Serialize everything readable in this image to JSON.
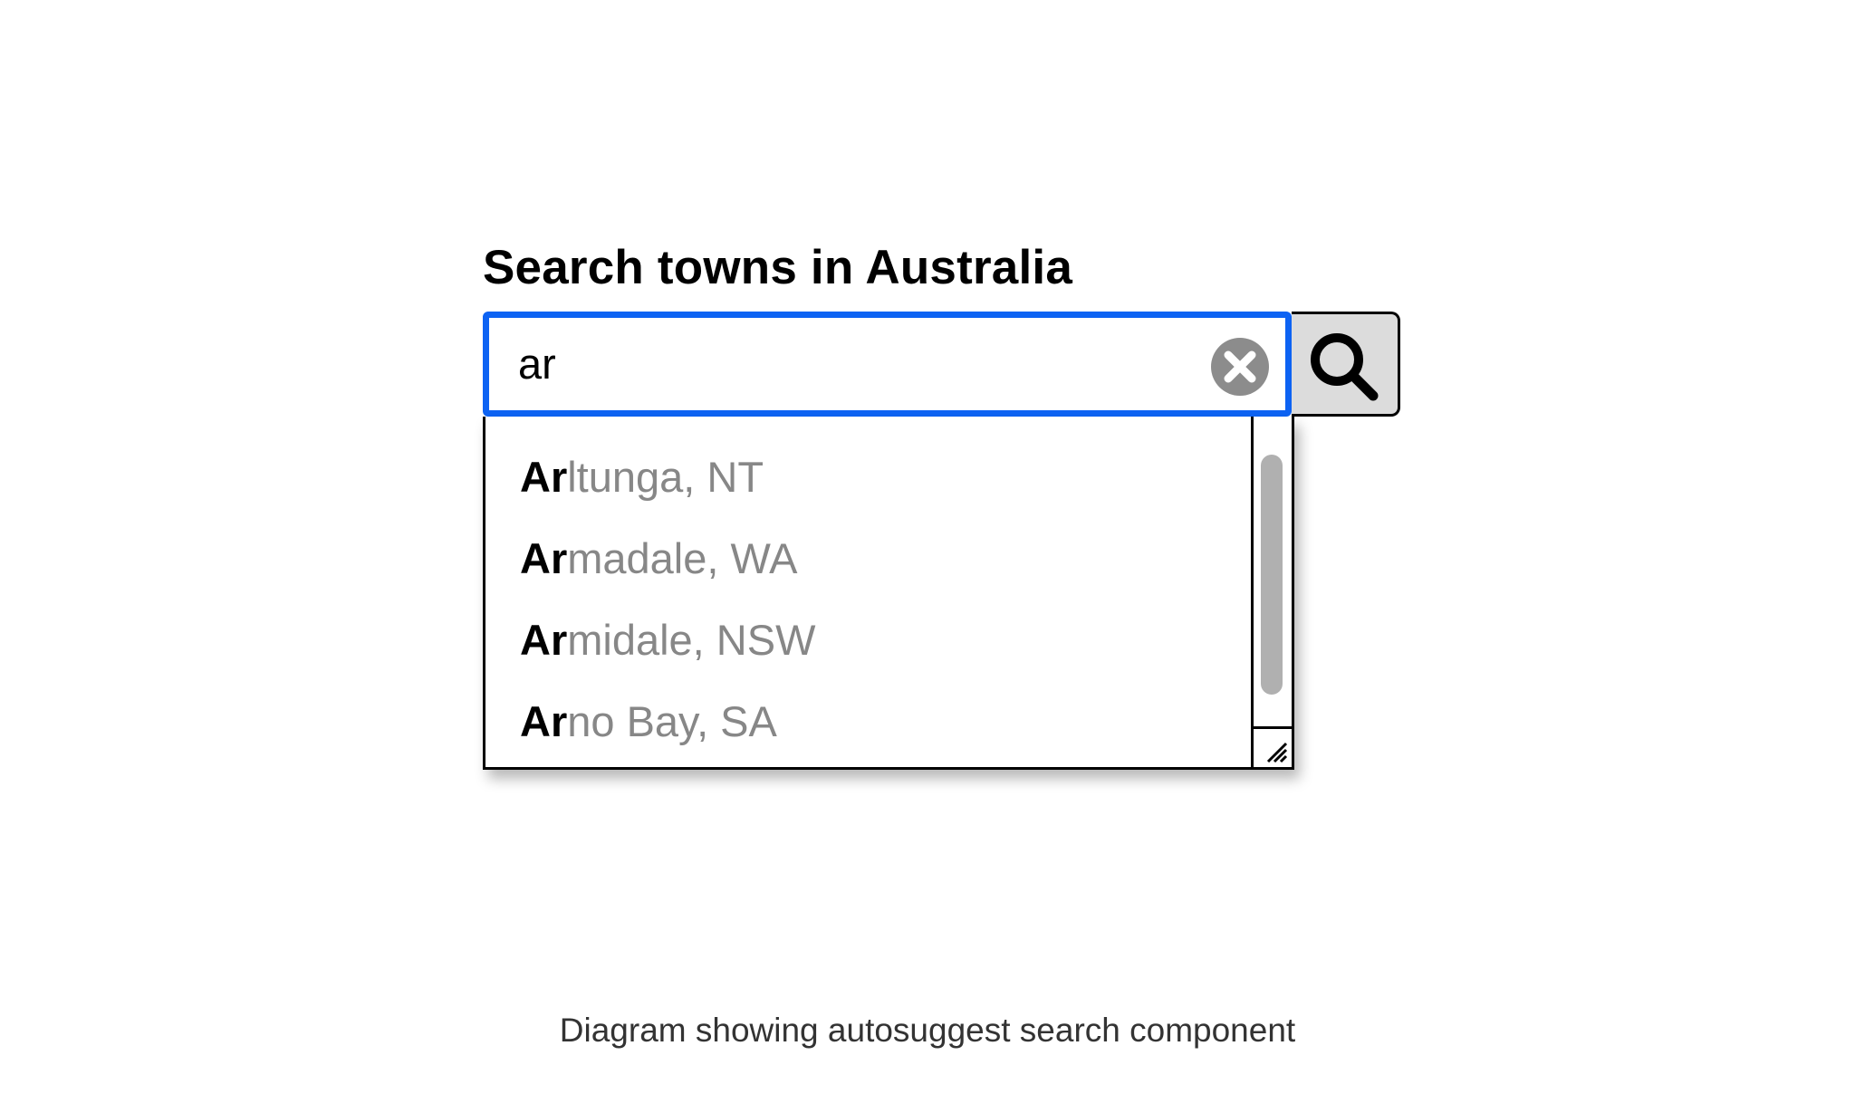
{
  "colors": {
    "focus_border": "#0d63f3",
    "search_button_bg": "#dcdcdc",
    "clear_icon": "#8c8c8c",
    "suggestion_rest_text": "#878787",
    "scroll_thumb": "#b0b0b0"
  },
  "form": {
    "label": "Search towns in Australia",
    "input_value": "ar",
    "clear_icon": "clear-circle-x-icon",
    "search_icon": "magnifier-icon"
  },
  "suggestions": [
    {
      "match": "Ar",
      "rest": "ltunga, NT"
    },
    {
      "match": "Ar",
      "rest": "madale, WA"
    },
    {
      "match": "Ar",
      "rest": "midale, NSW"
    },
    {
      "match": "Ar",
      "rest": "no Bay, SA"
    }
  ],
  "caption": "Diagram showing autosuggest search component"
}
